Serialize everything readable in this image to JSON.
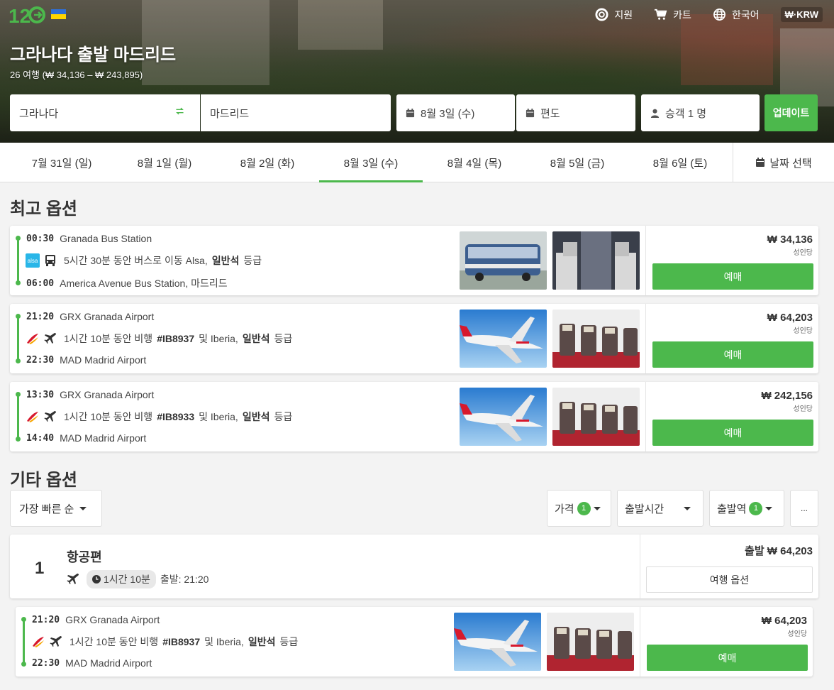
{
  "nav": {
    "support": "지원",
    "cart": "카트",
    "language": "한국어",
    "currency": "₩·KRW"
  },
  "header": {
    "title": "그라나다 출발 마드리드",
    "subtitle": "26 여행 (₩ 34,136 – ₩ 243,895)"
  },
  "search": {
    "from": "그라나다",
    "to": "마드리드",
    "date": "8월 3일 (수)",
    "return": "편도",
    "passengers": "승객 1 명",
    "update": "업데이트"
  },
  "dates": [
    "7월 31일 (일)",
    "8월 1일 (월)",
    "8월 2일 (화)",
    "8월 3일 (수)",
    "8월 4일 (목)",
    "8월 5일 (금)",
    "8월 6일 (토)"
  ],
  "date_picker": "날짜 선택",
  "best": {
    "title": "최고 옵션",
    "items": [
      {
        "dep_time": "00:30",
        "dep_place": "Granada Bus Station",
        "arr_time": "06:00",
        "arr_place": "America Avenue Bus Station, 마드리드",
        "desc_pre": "5시간 30분 동안 버스로 이동 Alsa,",
        "desc_bold": "일반석",
        "desc_post": "등급",
        "carrier": "alsa",
        "carrier_label": "alsa",
        "price": "₩ 34,136",
        "per": "성인당",
        "buy": "예매"
      },
      {
        "dep_time": "21:20",
        "dep_place": "GRX Granada Airport",
        "arr_time": "22:30",
        "arr_place": "MAD Madrid Airport",
        "desc_pre": "1시간 10분 동안 비행",
        "flight": "#IB8937",
        "desc_mid": "및 Iberia,",
        "desc_bold": "일반석",
        "desc_post": "등급",
        "carrier": "iberia",
        "price": "₩ 64,203",
        "per": "성인당",
        "buy": "예매"
      },
      {
        "dep_time": "13:30",
        "dep_place": "GRX Granada Airport",
        "arr_time": "14:40",
        "arr_place": "MAD Madrid Airport",
        "desc_pre": "1시간 10분 동안 비행",
        "flight": "#IB8933",
        "desc_mid": "및 Iberia,",
        "desc_bold": "일반석",
        "desc_post": "등급",
        "carrier": "iberia",
        "price": "₩ 242,156",
        "per": "성인당",
        "buy": "예매"
      }
    ]
  },
  "other": {
    "title": "기타 옵션",
    "sort": "가장 빠른 순",
    "filters": {
      "price": "가격",
      "price_count": "1",
      "departure": "출발시간",
      "station": "출발역",
      "station_count": "1",
      "more": "..."
    },
    "group": {
      "num": "1",
      "title": "항공편",
      "duration": "1시간 10분",
      "depart": "출발: 21:20",
      "price": "출발 ₩ 64,203",
      "options": "여행 옵션"
    },
    "item": {
      "dep_time": "21:20",
      "dep_place": "GRX Granada Airport",
      "arr_time": "22:30",
      "arr_place": "MAD Madrid Airport",
      "desc_pre": "1시간 10분 동안 비행",
      "flight": "#IB8937",
      "desc_mid": "및 Iberia,",
      "desc_bold": "일반석",
      "desc_post": "등급",
      "price": "₩ 64,203",
      "per": "성인당",
      "buy": "예매"
    }
  }
}
